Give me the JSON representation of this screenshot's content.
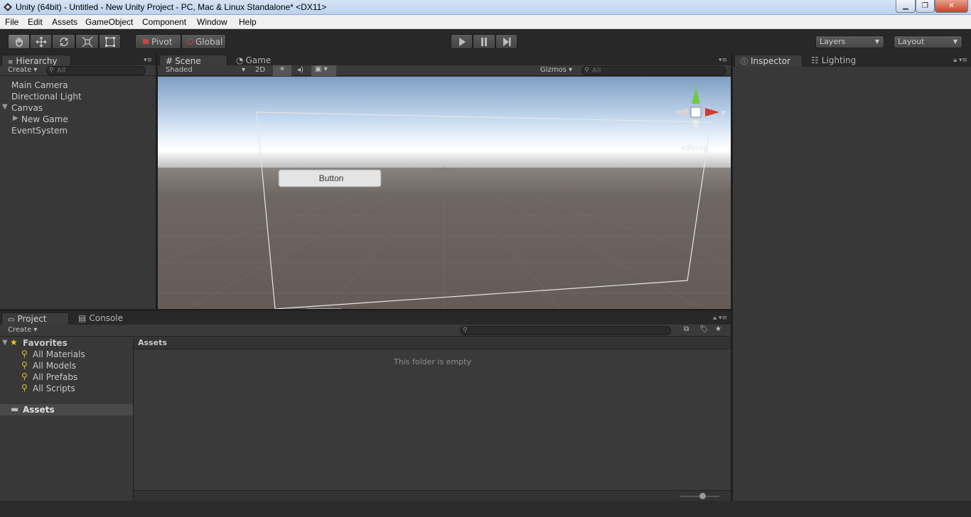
{
  "window": {
    "title": "Unity (64bit) - Untitled - New Unity Project - PC, Mac & Linux Standalone* <DX11>",
    "minimize": "▁",
    "maximize": "❐",
    "close": "✕"
  },
  "menu": [
    "File",
    "Edit",
    "Assets",
    "GameObject",
    "Component",
    "Window",
    "Help"
  ],
  "toolbar": {
    "pivot_label": "Pivot",
    "global_label": "Global",
    "layers_label": "Layers",
    "layout_label": "Layout"
  },
  "hierarchy": {
    "tab_label": "Hierarchy",
    "create_label": "Create",
    "search_placeholder": "All",
    "items": [
      "Main Camera",
      "Directional Light",
      "Canvas",
      "New Game",
      "EventSystem"
    ]
  },
  "scene": {
    "tab_scene": "Scene",
    "tab_game": "Game",
    "shading_mode": "Shaded",
    "mode_2d": "2D",
    "gizmos_label": "Gizmos",
    "search_placeholder": "All",
    "button_text": "Button",
    "persp_label": "Persp",
    "axis_y": "y",
    "axis_x": "x"
  },
  "inspector": {
    "tab_inspector": "Inspector",
    "tab_lighting": "Lighting"
  },
  "project": {
    "tab_project": "Project",
    "tab_console": "Console",
    "create_label": "Create",
    "favorites_label": "Favorites",
    "favorites": [
      "All Materials",
      "All Models",
      "All Prefabs",
      "All Scripts"
    ],
    "assets_label": "Assets",
    "breadcrumb": "Assets",
    "empty_message": "This folder is empty"
  },
  "colors": {
    "accent_y": "#6ecb3c",
    "accent_x": "#d63a2a",
    "sky_top": "#7e9ec3",
    "ground": "#645b56"
  }
}
